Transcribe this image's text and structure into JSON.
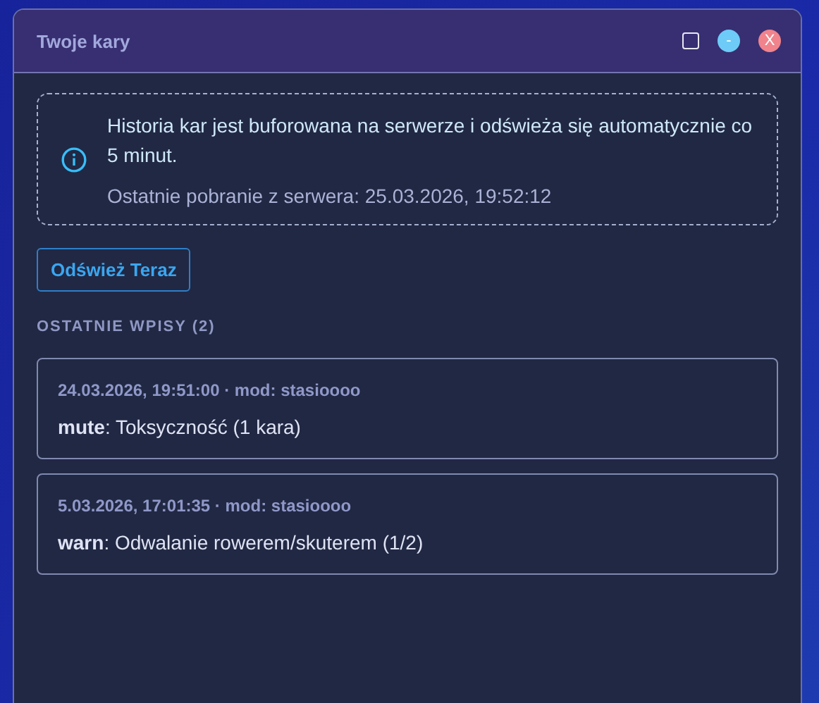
{
  "window": {
    "title": "Twoje kary",
    "controls": [
      {
        "kind": "maximize"
      },
      {
        "kind": "minimize",
        "label": "-"
      },
      {
        "kind": "close",
        "label": "X"
      }
    ]
  },
  "notice": {
    "message": "Historia kar jest buforowana na serwerze i odświeża się automatycznie co 5 minut.",
    "last_fetch": "Ostatnie pobranie z serwera: 25.03.2026, 19:52:12"
  },
  "refresh_button": "Odśwież Teraz",
  "section_title": "OSTATNIE WPISY (2)",
  "entries": [
    {
      "meta": "24.03.2026, 19:51:00 · mod: stasioooo",
      "text": "**mute**: Toksyczność (1 kara)"
    },
    {
      "meta": "5.03.2026, 17:01:35 · mod: stasioooo",
      "text": "**warn**: Odwalanie rowerem/skuterem (1/2)"
    }
  ]
}
